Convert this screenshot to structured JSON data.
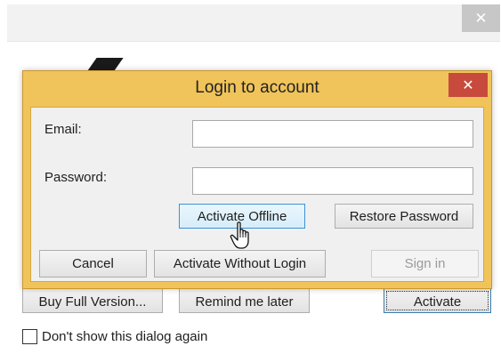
{
  "outer_window": {
    "close_glyph": "✕",
    "buttons": {
      "buy": "Buy Full Version...",
      "remind": "Remind me later",
      "activate": "Activate"
    },
    "dont_show_label": "Don't show this dialog again",
    "dont_show_checked": false
  },
  "login_dialog": {
    "title": "Login to account",
    "close_glyph": "✕",
    "email_label": "Email:",
    "email_value": "",
    "password_label": "Password:",
    "password_value": "",
    "activate_offline_label": "Activate Offline",
    "restore_password_label": "Restore Password",
    "cancel_label": "Cancel",
    "activate_without_login_label": "Activate Without Login",
    "sign_in_label": "Sign in",
    "sign_in_enabled": false
  },
  "colors": {
    "dialog_frame": "#f0c45a",
    "dialog_close": "#c74a3d",
    "hover_border": "#3c93d3"
  },
  "cursor_icon": "hand-pointer-icon"
}
